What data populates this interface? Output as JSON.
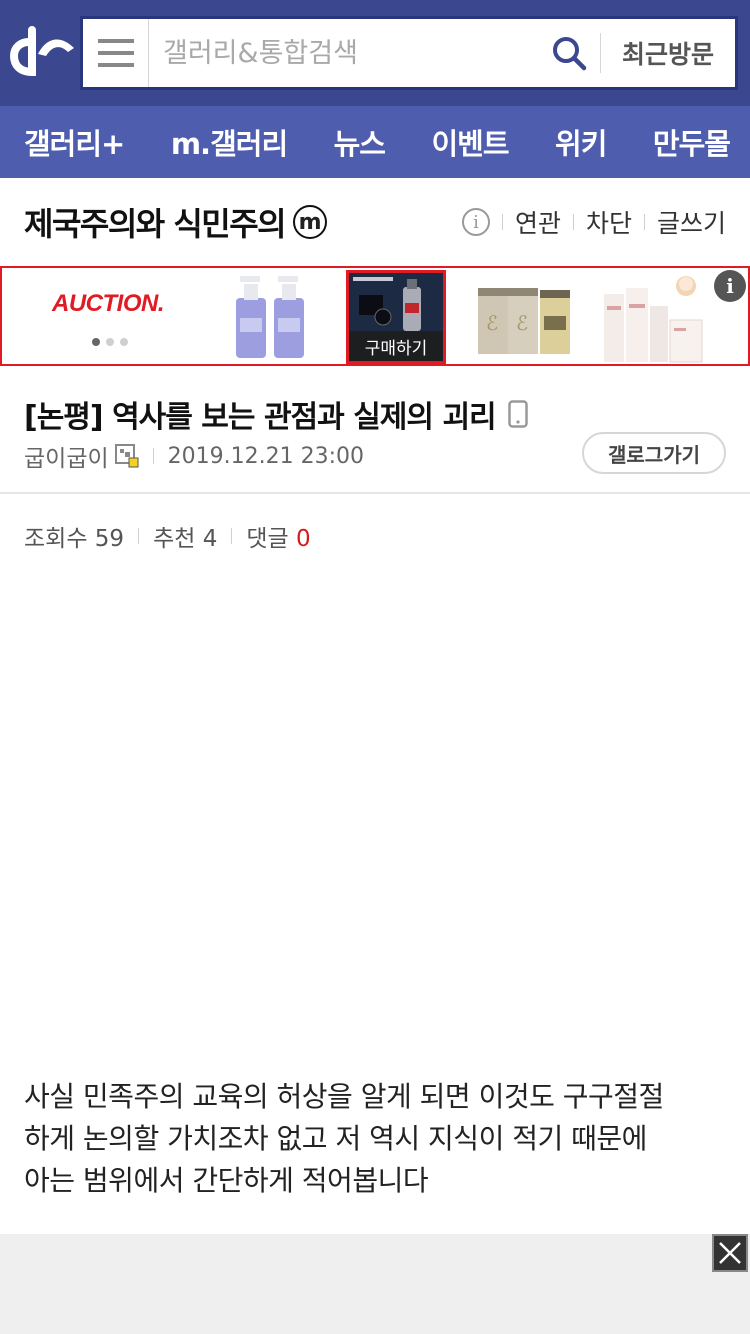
{
  "header": {
    "search_placeholder": "갤러리&통합검색",
    "recent_label": "최근방문"
  },
  "nav": {
    "items": [
      "갤러리+",
      "m.갤러리",
      "뉴스",
      "이벤트",
      "위키",
      "만두몰"
    ]
  },
  "gallery": {
    "title": "제국주의와 식민주의",
    "badge": "m",
    "actions": [
      "연관",
      "차단",
      "글쓰기"
    ]
  },
  "ad": {
    "brand": "AUCTION.",
    "buy_label": "구매하기",
    "info_label": "i"
  },
  "article": {
    "title": "[논평] 역사를 보는 관점과 실제의 괴리",
    "author": "굽이굽이",
    "date": "2019.12.21 23:00",
    "gallog_label": "갤로그가기",
    "views_label": "조회수 59",
    "recommend_label": "추천 4",
    "reply_label": "댓글",
    "reply_count": "0",
    "body_lines": [
      "사실 민족주의 교육의 허상을 알게 되면 이것도 구구절절",
      "하게 논의할 가치조차 없고 저 역시 지식이 적기 때문에",
      "아는 범위에서 간단하게 적어봅니다"
    ]
  },
  "colors": {
    "header_bg": "#3b4890",
    "nav_bg": "#4e5dad",
    "ad_border": "#e01b24",
    "reply_count": "#d41c1c"
  }
}
